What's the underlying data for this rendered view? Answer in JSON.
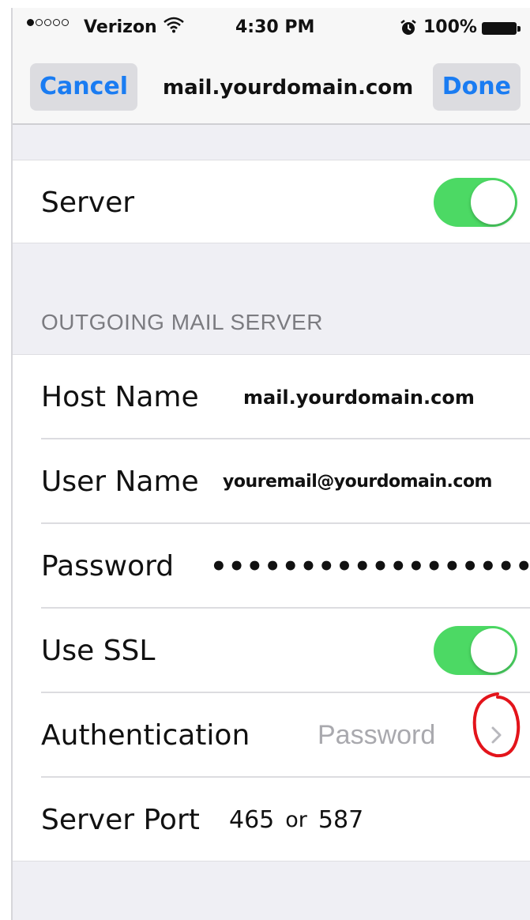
{
  "status_bar": {
    "carrier": "Verizon",
    "time": "4:30 PM",
    "battery": "100%",
    "signal_bars_filled": 1,
    "signal_bars_total": 5,
    "icons": [
      "wifi-icon",
      "alarm-icon",
      "battery-icon"
    ]
  },
  "nav": {
    "cancel_label": "Cancel",
    "title": "mail.yourdomain.com",
    "done_label": "Done"
  },
  "server_row": {
    "label": "Server",
    "enabled": true
  },
  "outgoing": {
    "header": "OUTGOING MAIL SERVER",
    "host": {
      "label": "Host Name",
      "value": "mail.yourdomain.com"
    },
    "user": {
      "label": "User Name",
      "value": "youremail@yourdomain.com"
    },
    "password": {
      "label": "Password",
      "value": "••••••••••••••••••"
    },
    "ssl": {
      "label": "Use SSL",
      "enabled": true
    },
    "auth": {
      "label": "Authentication",
      "value": "Password"
    },
    "port": {
      "label": "Server Port",
      "value_a": "465",
      "or": "or",
      "value_b": "587"
    }
  },
  "colors": {
    "accent": "#1a7cf2",
    "toggle_on": "#4cd964",
    "annotation": "#e3141b",
    "background": "#efeff4"
  }
}
